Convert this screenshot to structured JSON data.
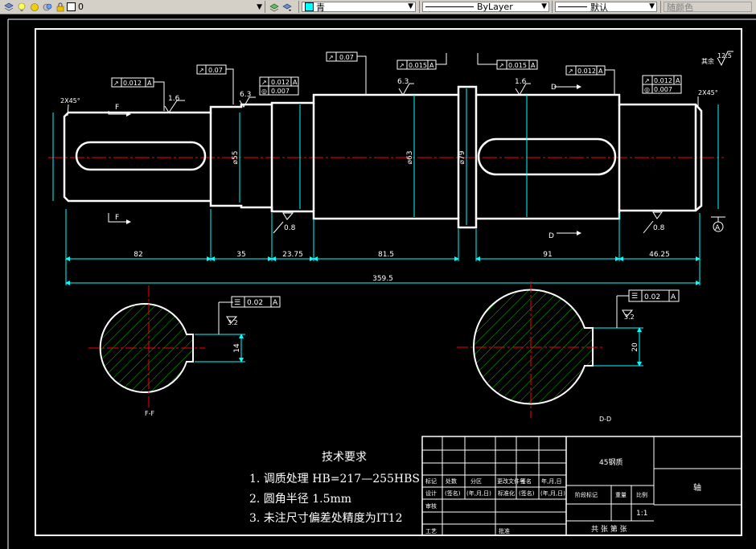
{
  "toolbar": {
    "layer_name": "0",
    "color_name": "青",
    "linetype": "ByLayer",
    "lineweight": "默认",
    "plotstyle": "随颜色"
  },
  "drawing": {
    "dim_labels": {
      "len_82": "82",
      "len_35": "35",
      "len_23_75": "23.75",
      "len_81_5": "81.5",
      "len_91": "91",
      "len_46_25": "46.25",
      "total_359_5": "359.5",
      "dia_55": "⌀55",
      "dia_63": "⌀63",
      "dia_79": "⌀79",
      "keyway_14": "14",
      "keyway_20": "20",
      "keydepth_3_2a": "3.2",
      "keydepth_3_2b": "3.2"
    },
    "tolerances": {
      "t1": "0.012",
      "t2": "0.07",
      "t3": "0.012",
      "t3b": "0.007",
      "t4": "0.07",
      "t5": "0.015",
      "t6": "0.015",
      "t7": "0.012",
      "t8": "0.012",
      "t8b": "0.007",
      "sym1": "0.02",
      "sym2": "0.02",
      "datum": "A"
    },
    "roughness": {
      "r1": "1.6",
      "r2": "6.3",
      "r3": "6.3",
      "r4": "1.6",
      "r5": "0.8",
      "r6": "0.8",
      "r7": "12.5",
      "rest_label": "其余"
    },
    "chamfer_left": "2X45°",
    "chamfer_right": "2X45°",
    "section_F": "F",
    "section_D": "D",
    "section_label_F": "F-F",
    "section_label_D": "D-D"
  },
  "tech_requirements": {
    "title": "技术要求",
    "items": [
      "1. 调质处理 HB=217—255HBS",
      "2. 圆角半径  1.5mm",
      "3. 未注尺寸偏差处精度为IT12"
    ]
  },
  "title_block": {
    "material": "45钢质",
    "part_name": "轴",
    "scale": "1:1",
    "sheets": "共 张 第 张",
    "h_mark": "标记",
    "h_qty": "处数",
    "h_zone": "分区",
    "h_docno": "更改文件号",
    "h_sign": "签名",
    "h_date": "年,月,日",
    "h_design": "设计",
    "h_sign2": "(签名)",
    "h_date2": "(年,月,日)",
    "h_std": "标准化",
    "h_sign3": "(签名)",
    "h_date3": "(年,月,日)",
    "h_stage": "阶段标记",
    "h_weight": "重量",
    "h_ratio": "比例",
    "h_check": "审核",
    "h_process": "工艺",
    "h_approve": "批准"
  },
  "colors": {
    "background": "#000000",
    "outline": "#ffffff",
    "dimension": "#00ffff",
    "centerline": "#ff0000",
    "hatch": "#00ff00"
  }
}
